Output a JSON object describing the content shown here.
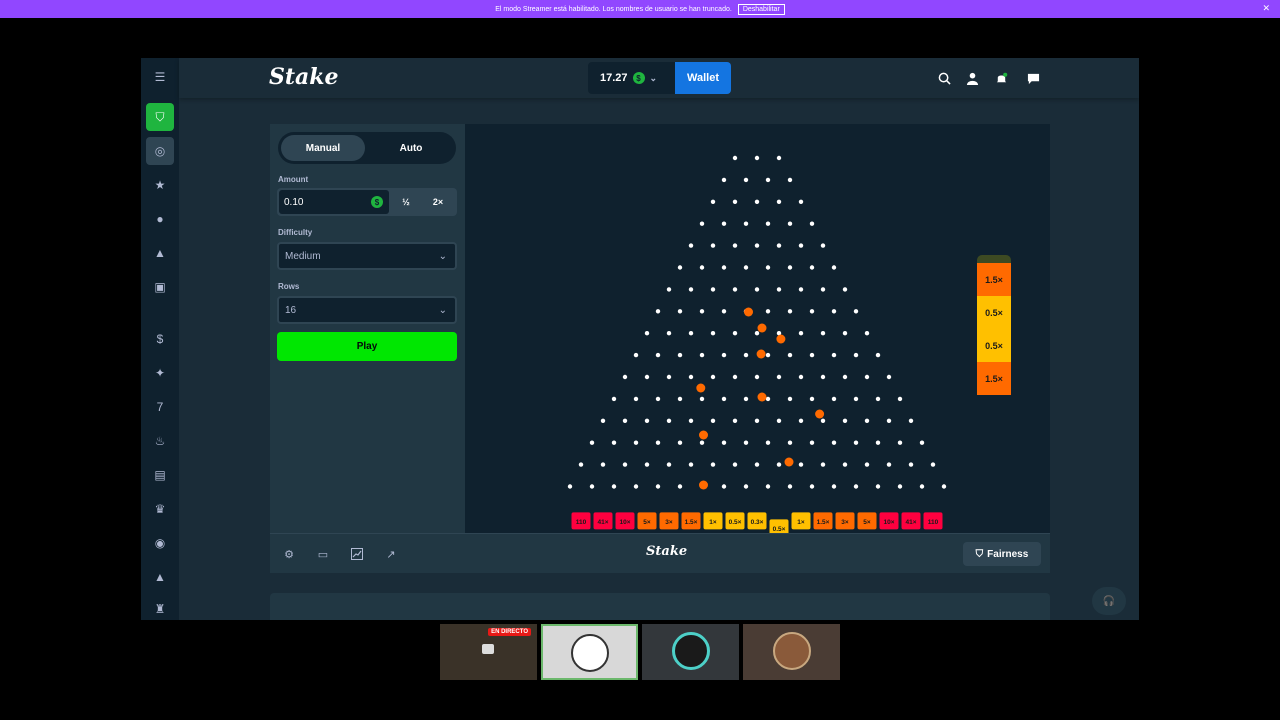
{
  "banner": {
    "text": "El modo Streamer está habilitado. Los nombres de usuario se han truncado.",
    "button": "Deshabilitar",
    "close": "✕"
  },
  "header": {
    "logo": "Stake",
    "balance": "17.27",
    "currency_symbol": "$",
    "wallet": "Wallet"
  },
  "controls": {
    "tab_manual": "Manual",
    "tab_auto": "Auto",
    "amount_label": "Amount",
    "amount_value": "0.10",
    "half": "½",
    "double": "2×",
    "difficulty_label": "Difficulty",
    "difficulty_value": "Medium",
    "rows_label": "Rows",
    "rows_value": "16",
    "play": "Play"
  },
  "board": {
    "rows": 16,
    "multipliers": [
      "110",
      "41×",
      "10×",
      "5×",
      "3×",
      "1.5×",
      "1×",
      "0.5×",
      "0.3×",
      "0.5×",
      "1×",
      "1.5×",
      "3×",
      "5×",
      "10×",
      "41×",
      "110"
    ],
    "history": [
      "1.5×",
      "0.5×",
      "0.5×",
      "1.5×"
    ],
    "colors": {
      "red": "#ff003f",
      "orange": "#ff6a00",
      "amber": "#ffc000",
      "peg": "#ffffff",
      "ball": "#ff6a00"
    }
  },
  "footer": {
    "logo": "Stake",
    "fairness": "Fairness"
  },
  "cams": {
    "live_badge": "EN DIRECTO"
  },
  "icons": [
    "menu-icon",
    "shield-icon",
    "target-icon",
    "star-icon",
    "clock-icon",
    "cone-icon",
    "card-icon",
    "coin-icon",
    "sparkle-icon",
    "seven-icon",
    "fire-icon",
    "ticket-icon",
    "crown-icon",
    "soccer-icon",
    "cone-icon",
    "trophy-icon",
    "search-icon",
    "user-icon",
    "bell-icon",
    "chat-icon",
    "gear-icon",
    "square-icon",
    "chart-icon",
    "expand-icon",
    "headset-icon"
  ]
}
